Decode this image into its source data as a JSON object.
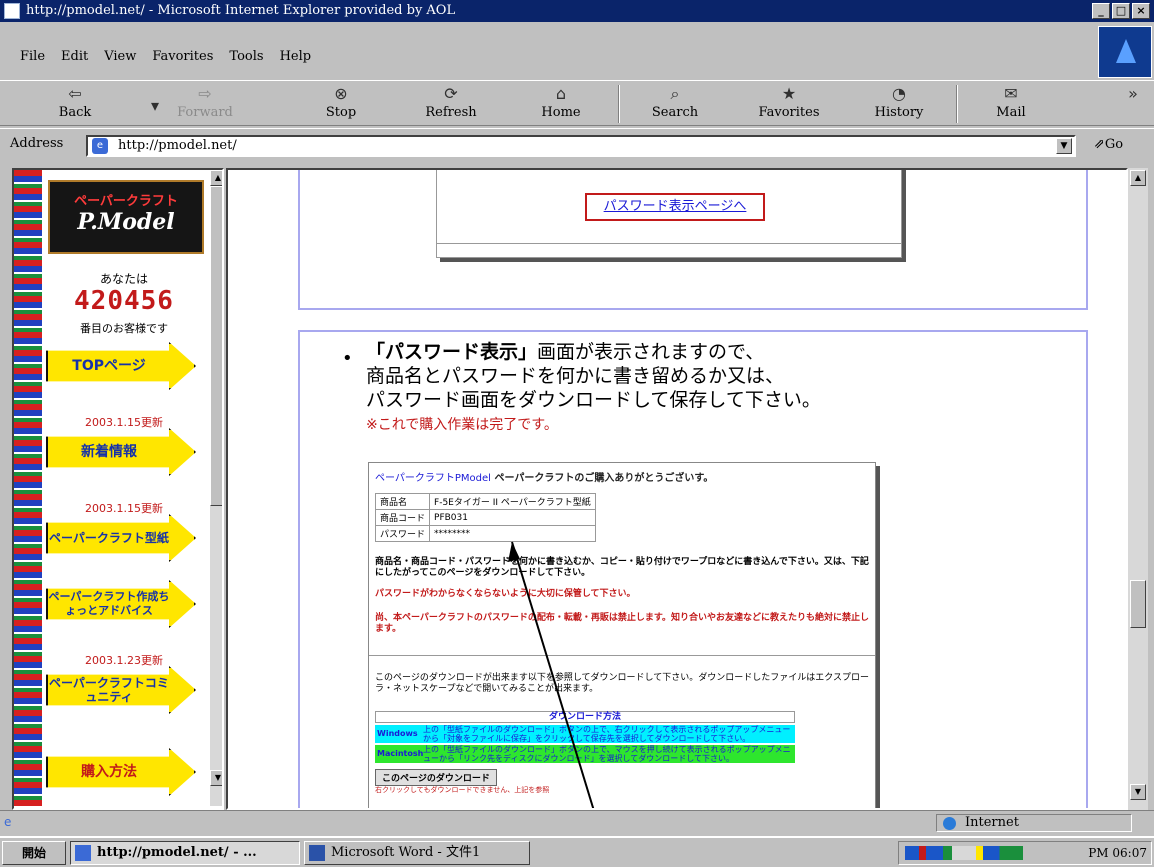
{
  "window": {
    "title": "http://pmodel.net/ - Microsoft Internet Explorer provided by AOL",
    "controls": {
      "minimize": "_",
      "maximize": "□",
      "close": "×"
    }
  },
  "menu": [
    "File",
    "Edit",
    "View",
    "Favorites",
    "Tools",
    "Help"
  ],
  "toolbar": {
    "back": "Back",
    "forward": "Forward",
    "stop": "Stop",
    "refresh": "Refresh",
    "home": "Home",
    "search": "Search",
    "favorites": "Favorites",
    "history": "History",
    "mail": "Mail",
    "more": "»"
  },
  "address": {
    "label": "Address",
    "value": "http://pmodel.net/",
    "go": "Go"
  },
  "left_frame": {
    "logo_top": "ペーパークラフト",
    "logo_main": "P.Model",
    "counter_label": "あなたは",
    "counter": "420456",
    "counter_sub": "番目のお客様です",
    "nav": [
      {
        "label": "TOPページ"
      },
      {
        "update": "2003.1.15更新",
        "label": "新着情報"
      },
      {
        "update": "2003.1.15更新",
        "label": "ペーパークラフト型紙"
      },
      {
        "label": "ペーパークラフト作成ちょっとアドバイス"
      },
      {
        "update": "2003.1.23更新",
        "label": "ペーパークラフトコミュニティ"
      },
      {
        "label": "購入方法"
      }
    ]
  },
  "main": {
    "password_link": "パスワード表示ページへ",
    "instruction_bold": "「パスワード表示」",
    "instruction_rest": "画面が表示されますので、",
    "instruction_line2": "商品名とパスワードを何かに書き留めるか又は、",
    "instruction_line3": "パスワード画面をダウンロードして保存して下さい。",
    "note": "※これで購入作業は完了です。",
    "shot": {
      "title_link": "ペーパークラフトPModel",
      "title_rest": " ペーパークラフトのご購入ありがとうございす。",
      "rows": [
        {
          "k": "商品名",
          "v": "F-5Eタイガー II ペーパークラフト型紙"
        },
        {
          "k": "商品コード",
          "v": "PFB031"
        },
        {
          "k": "パスワード",
          "v": "********"
        }
      ],
      "p1": "商品名・商品コード・パスワードを何かに書き込むか、コピー・貼り付けでワープロなどに書き込んで下さい。又は、下記にしたがってこのページをダウンロードして下さい。",
      "p2": "パスワードがわからなくならないように大切に保管して下さい。",
      "p3": "尚、本ペーパークラフトのパスワードの配布・転載・再販は禁止します。知り合いやお友達などに教えたりも絶対に禁止します。",
      "p4": "このページのダウンロードが出来ます以下を参照してダウンロードして下さい。ダウンロードしたファイルはエクスプローラ・ネットスケープなどで開いてみることが出来ます。",
      "dl_head": "ダウンロード方法",
      "dl_rows": [
        {
          "k": "Windows →",
          "v": "上の「型紙ファイルのダウンロード」ボタンの上で、右クリックして表示されるポップアップメニューから「対象をファイルに保存」をクリックして保存先を選択してダウンロードして下さい。"
        },
        {
          "k": "Macintosh →",
          "v": "上の「型紙ファイルのダウンロード」ボタンの上で、マウスを押し続けて表示されるポップアップメニューから「リンク先をディスクにダウンロード」を選択してダウンロードして下さい。"
        }
      ],
      "dl_button": "このページのダウンロード",
      "dl_small": "右クリックしてもダウンロードできません、上記を参照"
    }
  },
  "status": {
    "zone": "Internet"
  },
  "taskbar": {
    "start": "開始",
    "items": [
      "http://pmodel.net/ - ...",
      "Microsoft Word - 文件1"
    ],
    "clock": "PM 06:07"
  }
}
